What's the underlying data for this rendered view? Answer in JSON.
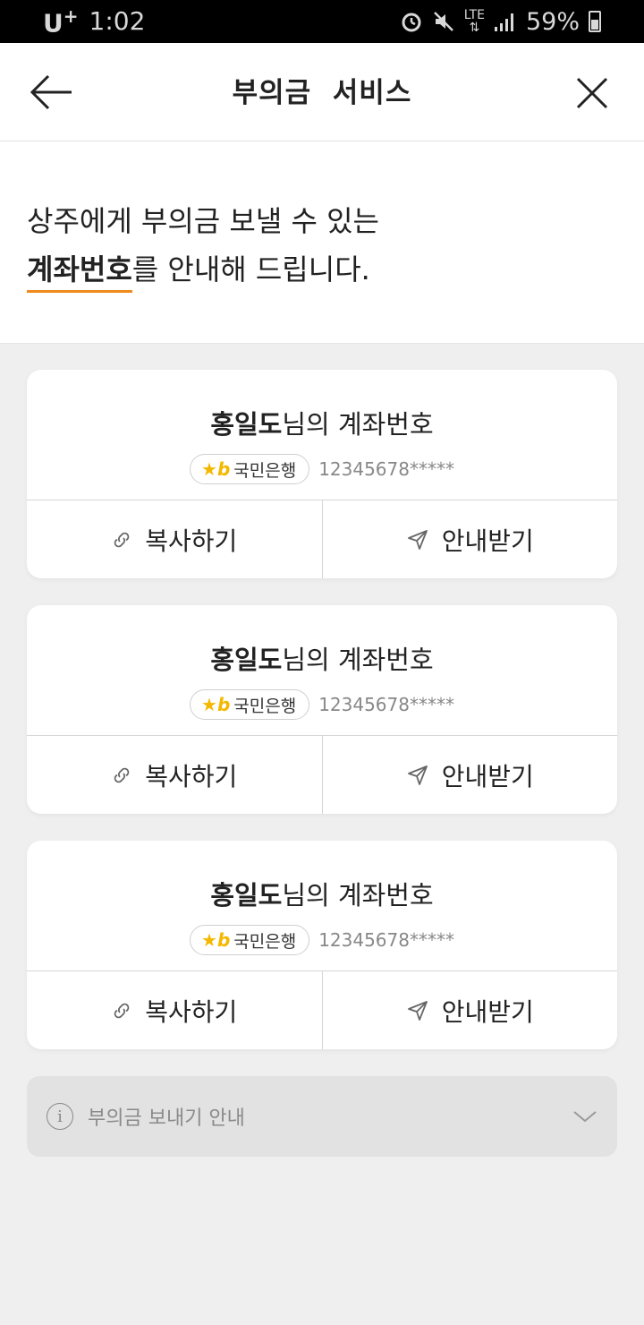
{
  "status_bar": {
    "carrier": "U",
    "carrier_plus": "+",
    "time": "1:02",
    "network": "LTE",
    "battery": "59%"
  },
  "header": {
    "title": "부의금  서비스",
    "back_icon": "arrow-left-icon",
    "close_icon": "close-icon"
  },
  "intro": {
    "line1": "상주에게 부의금 보낼 수 있는",
    "emphasis": "계좌번호",
    "line2_rest": "를 안내해 드립니다."
  },
  "cards": [
    {
      "name": "홍일도",
      "title_suffix": "님의 계좌번호",
      "bank_logo": "★b",
      "bank": "국민은행",
      "account": "12345678*****",
      "copy_label": "복사하기",
      "receive_label": "안내받기"
    },
    {
      "name": "홍일도",
      "title_suffix": "님의 계좌번호",
      "bank_logo": "★b",
      "bank": "국민은행",
      "account": "12345678*****",
      "copy_label": "복사하기",
      "receive_label": "안내받기"
    },
    {
      "name": "홍일도",
      "title_suffix": "님의 계좌번호",
      "bank_logo": "★b",
      "bank": "국민은행",
      "account": "12345678*****",
      "copy_label": "복사하기",
      "receive_label": "안내받기"
    }
  ],
  "info_bar": {
    "icon_text": "i",
    "label": "부의금 보내기 안내"
  },
  "colors": {
    "accent_underline": "#f08a1c",
    "kb_yellow": "#f5b800",
    "background": "#efefef"
  }
}
